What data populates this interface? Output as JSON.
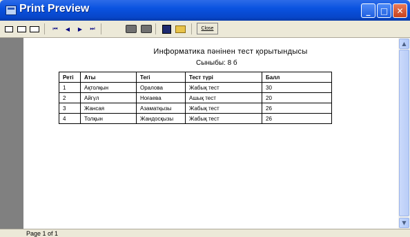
{
  "window": {
    "title": "Print Preview"
  },
  "toolbar": {
    "close_label": "Close"
  },
  "report": {
    "title": "Информатика пәнінен тест қорытындысы",
    "subtitle": "Сыныбы: 8 б",
    "columns": [
      "Реті",
      "Аты",
      "Тегі",
      "Тест түрі",
      "Балл"
    ],
    "rows": [
      [
        "1",
        "Ақтолқын",
        "Оралова",
        "Жабық тест",
        "30"
      ],
      [
        "2",
        "Айгүл",
        "Ноғаева",
        "Ашық тест",
        "20"
      ],
      [
        "3",
        "Жансая",
        "Азаматқызы",
        "Жабық тест",
        "26"
      ],
      [
        "4",
        "Толқын",
        "Жандосқызы",
        "Жабық тест",
        "26"
      ]
    ]
  },
  "status": {
    "page": "Page 1 of 1"
  }
}
